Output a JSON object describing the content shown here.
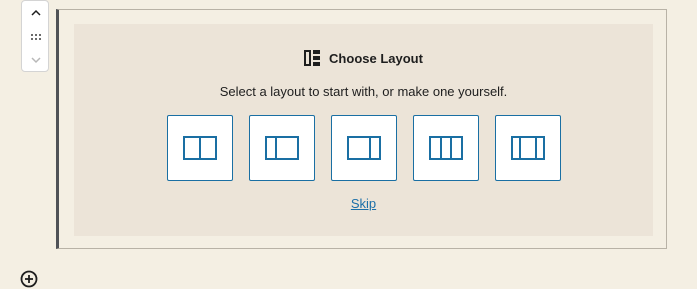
{
  "placeholder": {
    "title": "Choose Layout",
    "instructions": "Select a layout to start with, or make one yourself.",
    "skip_label": "Skip",
    "accent_color": "#1a6fa3",
    "layouts": [
      {
        "icon": "layout-50-50-icon"
      },
      {
        "icon": "layout-30-70-icon"
      },
      {
        "icon": "layout-70-30-icon"
      },
      {
        "icon": "layout-33-33-33-icon"
      },
      {
        "icon": "layout-25-50-25-icon"
      }
    ]
  },
  "toolbar": {
    "icons": [
      "chevron-up-icon",
      "drag-handle-icon",
      "chevron-down-icon"
    ]
  },
  "inserter": {
    "icon": "plus-circle-icon"
  }
}
